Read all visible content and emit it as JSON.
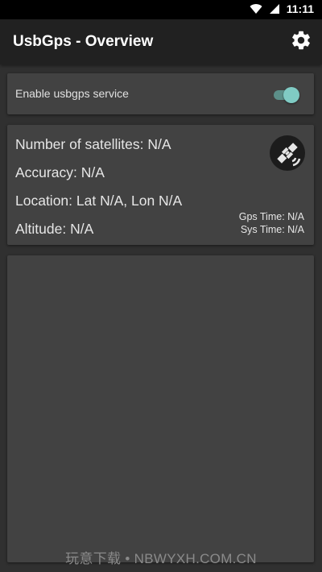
{
  "status_bar": {
    "time": "11:11",
    "icons": [
      "wifi-icon",
      "signal-icon"
    ]
  },
  "app_bar": {
    "title": "UsbGps - Overview",
    "settings_icon": "gear-icon"
  },
  "service_card": {
    "label": "Enable usbgps service",
    "enabled": true
  },
  "info_card": {
    "satellites": "Number of satellites: N/A",
    "accuracy": "Accuracy: N/A",
    "location": "Location: Lat N/A, Lon N/A",
    "altitude": "Altitude: N/A",
    "gps_time": "Gps Time: N/A",
    "sys_time": "Sys Time: N/A",
    "status_icon": "satellite-icon"
  },
  "watermark": "玩意下载 • NBWYXH.COM.CN",
  "colors": {
    "background": "#303030",
    "app_bar": "#212121",
    "card": "#424242",
    "accent": "#80cbc4"
  }
}
